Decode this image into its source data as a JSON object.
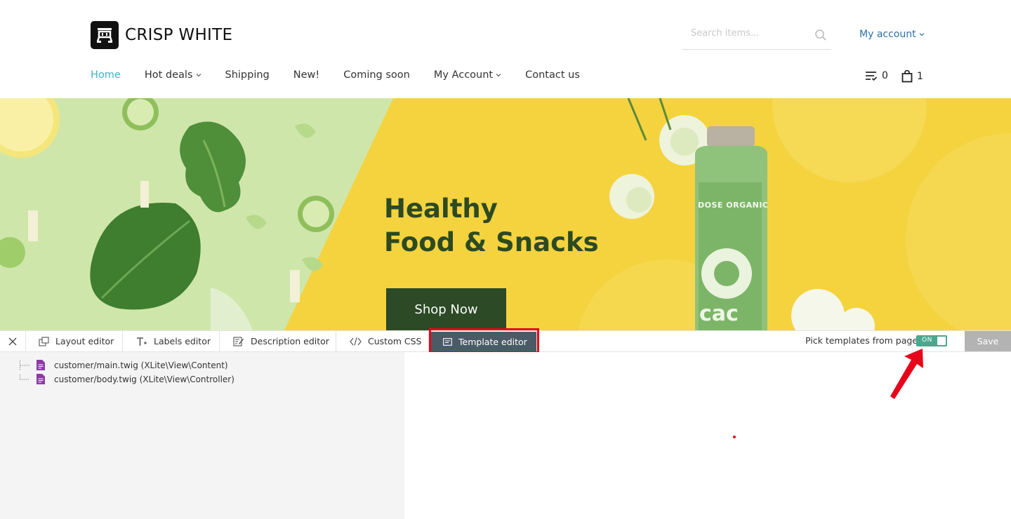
{
  "store": {
    "name": "CRISP WHITE",
    "search_placeholder": "Search items...",
    "account_label": "My account"
  },
  "nav": {
    "items": [
      {
        "label": "Home",
        "active": true,
        "dropdown": false
      },
      {
        "label": "Hot deals",
        "active": false,
        "dropdown": true
      },
      {
        "label": "Shipping",
        "active": false,
        "dropdown": false
      },
      {
        "label": "New!",
        "active": false,
        "dropdown": false
      },
      {
        "label": "Coming soon",
        "active": false,
        "dropdown": false
      },
      {
        "label": "My Account",
        "active": false,
        "dropdown": true
      },
      {
        "label": "Contact us",
        "active": false,
        "dropdown": false
      }
    ],
    "compare_count": "0",
    "cart_count": "1"
  },
  "banner": {
    "headline_line1": "Healthy",
    "headline_line2": "Food & Snacks",
    "button_label": "Shop Now",
    "bottle_brand": "DOSE ORGANIC",
    "bottle_word": "cac"
  },
  "toolbar": {
    "tabs": [
      {
        "label": "Layout editor",
        "icon": "layout-icon"
      },
      {
        "label": "Labels editor",
        "icon": "text-icon"
      },
      {
        "label": "Description editor",
        "icon": "edit-icon"
      },
      {
        "label": "Custom CSS",
        "icon": "code-icon"
      },
      {
        "label": "Template editor",
        "icon": "template-icon",
        "active": true
      }
    ],
    "pick_label": "Pick templates from page",
    "toggle_label": "ON",
    "save_label": "Save"
  },
  "templates": [
    "customer/main.twig (XLite\\View\\Content)",
    "customer/body.twig (XLite\\View\\Controller)"
  ],
  "colors": {
    "accent": "#3fb2c9",
    "link": "#2a6fa8",
    "active_tab": "#4c5a67",
    "highlight": "#e6051a",
    "toggle_on": "#4aa88f",
    "button_dark": "#2b4a25"
  }
}
